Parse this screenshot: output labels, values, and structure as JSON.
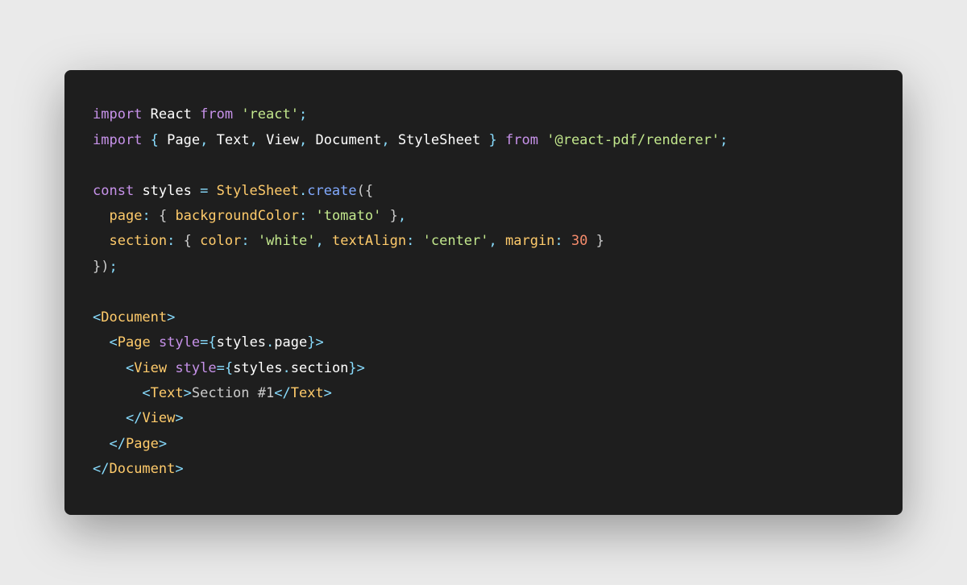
{
  "code": {
    "line1": {
      "import": "import",
      "react": "React",
      "from": "from",
      "module": "'react'",
      "semi": ";"
    },
    "line2": {
      "import": "import",
      "lbrace": "{",
      "page": "Page",
      "text": "Text",
      "view": "View",
      "document": "Document",
      "stylesheet": "StyleSheet",
      "rbrace": "}",
      "from": "from",
      "module": "'@react-pdf/renderer'",
      "semi": ";"
    },
    "line4": {
      "const": "const",
      "styles": "styles",
      "eq": "=",
      "stylesheet": "StyleSheet",
      "dot": ".",
      "create": "create",
      "lparen": "(",
      "lbrace": "{"
    },
    "line5": {
      "page": "page",
      "colon": ":",
      "lbrace": "{",
      "bgcolor": "backgroundColor",
      "tomato": "'tomato'",
      "rbrace": "}",
      "comma": ","
    },
    "line6": {
      "section": "section",
      "colon": ":",
      "lbrace": "{",
      "color": "color",
      "white": "'white'",
      "textalign": "textAlign",
      "center": "'center'",
      "margin": "margin",
      "thirty": "30",
      "rbrace": "}"
    },
    "line7": {
      "rbrace": "}",
      "rparen": ")",
      "semi": ";"
    },
    "line9": {
      "lt": "<",
      "document": "Document",
      "gt": ">"
    },
    "line10": {
      "lt": "<",
      "page": "Page",
      "style": "style",
      "eq": "=",
      "lbrace": "{",
      "styles": "styles",
      "dot": ".",
      "pageprop": "page",
      "rbrace": "}",
      "gt": ">"
    },
    "line11": {
      "lt": "<",
      "view": "View",
      "style": "style",
      "eq": "=",
      "lbrace": "{",
      "styles": "styles",
      "dot": ".",
      "section": "section",
      "rbrace": "}",
      "gt": ">"
    },
    "line12": {
      "lt": "<",
      "text": "Text",
      "gt": ">",
      "content": "Section #1",
      "ltc": "</",
      "textc": "Text",
      "gtc": ">"
    },
    "line13": {
      "ltc": "</",
      "view": "View",
      "gt": ">"
    },
    "line14": {
      "ltc": "</",
      "page": "Page",
      "gt": ">"
    },
    "line15": {
      "ltc": "</",
      "document": "Document",
      "gt": ">"
    }
  }
}
